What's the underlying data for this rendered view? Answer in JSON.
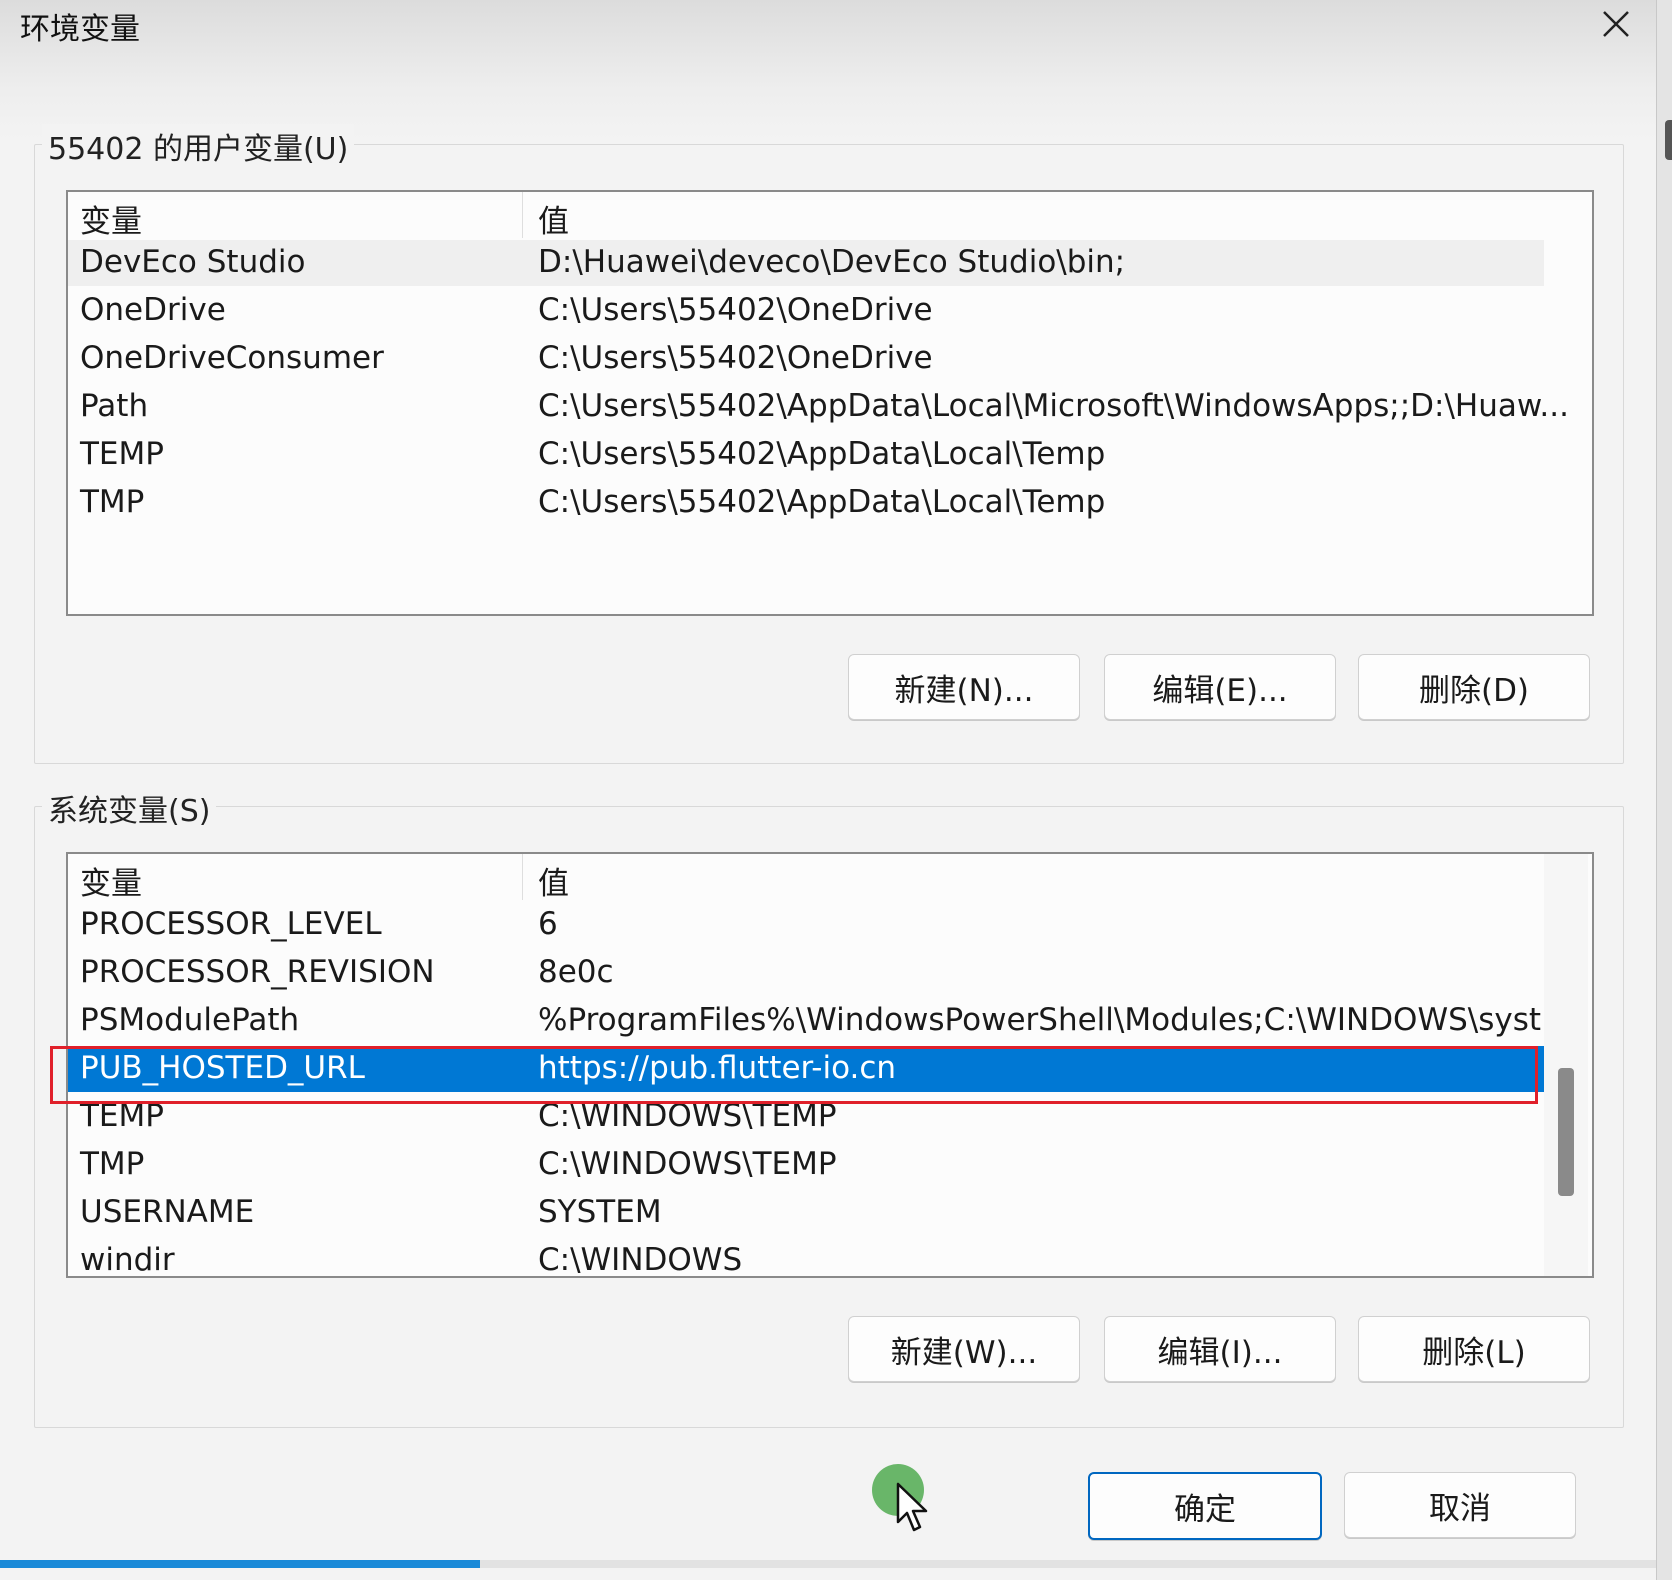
{
  "window": {
    "title": "环境变量"
  },
  "user_vars": {
    "group_label": "55402 的用户变量(U)",
    "headers": {
      "name": "变量",
      "value": "值"
    },
    "rows": [
      {
        "name": "DevEco Studio",
        "value": "D:\\Huawei\\deveco\\DevEco Studio\\bin;"
      },
      {
        "name": "OneDrive",
        "value": "C:\\Users\\55402\\OneDrive"
      },
      {
        "name": "OneDriveConsumer",
        "value": "C:\\Users\\55402\\OneDrive"
      },
      {
        "name": "Path",
        "value": "C:\\Users\\55402\\AppData\\Local\\Microsoft\\WindowsApps;;D:\\Huaw..."
      },
      {
        "name": "TEMP",
        "value": "C:\\Users\\55402\\AppData\\Local\\Temp"
      },
      {
        "name": "TMP",
        "value": "C:\\Users\\55402\\AppData\\Local\\Temp"
      }
    ],
    "buttons": {
      "new": "新建(N)...",
      "edit": "编辑(E)...",
      "delete": "删除(D)"
    }
  },
  "system_vars": {
    "group_label": "系统变量(S)",
    "headers": {
      "name": "变量",
      "value": "值"
    },
    "rows": [
      {
        "name": "PROCESSOR_LEVEL",
        "value": "6"
      },
      {
        "name": "PROCESSOR_REVISION",
        "value": "8e0c"
      },
      {
        "name": "PSModulePath",
        "value": "%ProgramFiles%\\WindowsPowerShell\\Modules;C:\\WINDOWS\\syst..."
      },
      {
        "name": "PUB_HOSTED_URL",
        "value": "https://pub.flutter-io.cn"
      },
      {
        "name": "TEMP",
        "value": "C:\\WINDOWS\\TEMP"
      },
      {
        "name": "TMP",
        "value": "C:\\WINDOWS\\TEMP"
      },
      {
        "name": "USERNAME",
        "value": "SYSTEM"
      },
      {
        "name": "windir",
        "value": "C:\\WINDOWS"
      }
    ],
    "selected_row": "PUB_HOSTED_URL",
    "buttons": {
      "new": "新建(W)...",
      "edit": "编辑(I)...",
      "delete": "删除(L)"
    }
  },
  "footer": {
    "ok": "确定",
    "cancel": "取消"
  },
  "colors": {
    "selection": "#0078d4",
    "highlight_box": "#e0202a",
    "accent": "#0067c0"
  },
  "video_progress": 0.29
}
